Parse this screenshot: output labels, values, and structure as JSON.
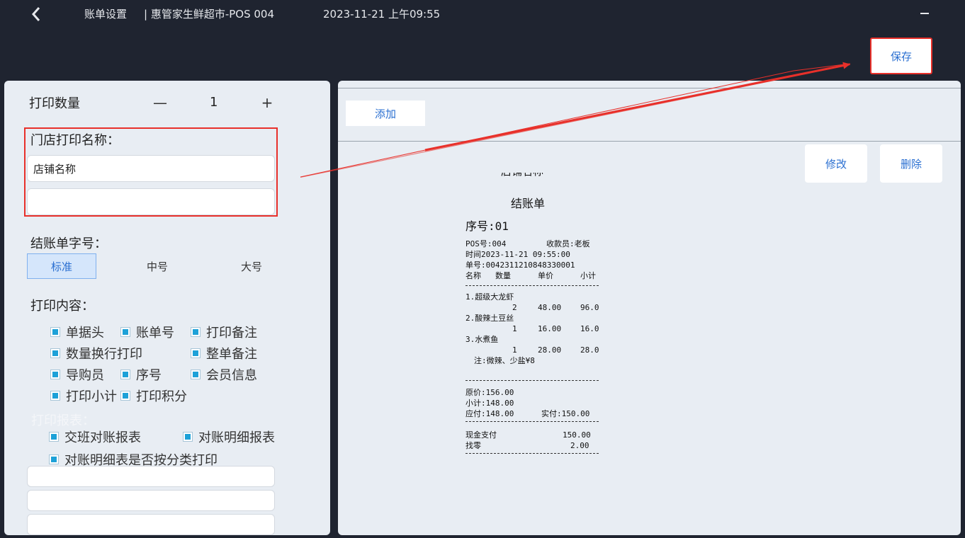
{
  "header": {
    "title": "账单设置",
    "store": "| 惠管家生鲜超市-POS 004",
    "datetime": "2023-11-21 上午09:55"
  },
  "actions": {
    "save": "保存",
    "add": "添加",
    "edit": "修改",
    "delete": "删除"
  },
  "colors": {
    "accent": "#2a6fd1",
    "highlight": "#e8302a",
    "checkbox": "#1da1d8",
    "background": "#1f2430"
  },
  "left": {
    "print_qty_label": "打印数量",
    "qty_minus": "—",
    "qty_value": "1",
    "qty_plus": "+",
    "store_name_label": "门店打印名称：",
    "store_name_value": "店铺名称",
    "store_name_second": "",
    "font_size_label": "结账单字号：",
    "font_sizes": [
      "标准",
      "中号",
      "大号"
    ],
    "content_label": "打印内容：",
    "content_options": [
      "单据头",
      "账单号",
      "打印备注",
      "数量换行打印",
      "整单备注",
      "导购员",
      "序号",
      "会员信息",
      "打印小计",
      "打印积分"
    ],
    "report_label": "打印报表：",
    "report_options": [
      "交班对账报表",
      "对账明细报表",
      "对账明细表是否按分类打印"
    ]
  },
  "receipt": {
    "store": "店铺名称",
    "title": "结账单",
    "seq": "序号:01",
    "pos_no": "POS号:004",
    "cashier": "收款员:老板",
    "time": "时间2023-11-21 09:55:00",
    "order_no": "单号:0042311210848330001",
    "columns": [
      "名称",
      "数量",
      "单价",
      "小计"
    ],
    "items": [
      {
        "name": "1.超级大龙虾",
        "qty": "2",
        "price": "48.00",
        "subtotal": "96.00"
      },
      {
        "name": "2.酸辣土豆丝",
        "qty": "1",
        "price": "16.00",
        "subtotal": "16.00"
      },
      {
        "name": "3.水煮鱼",
        "qty": "1",
        "price": "28.00",
        "subtotal": "28.00"
      }
    ],
    "note": "注:微辣、少盐¥8",
    "original_price": "原价:156.00",
    "subtotal": "小计:148.00",
    "payable": "应付:148.00",
    "paid": "实付:150.00",
    "cash_label": "现金支付",
    "cash_value": "150.00",
    "change_label": "找零",
    "change_value": "2.00"
  }
}
